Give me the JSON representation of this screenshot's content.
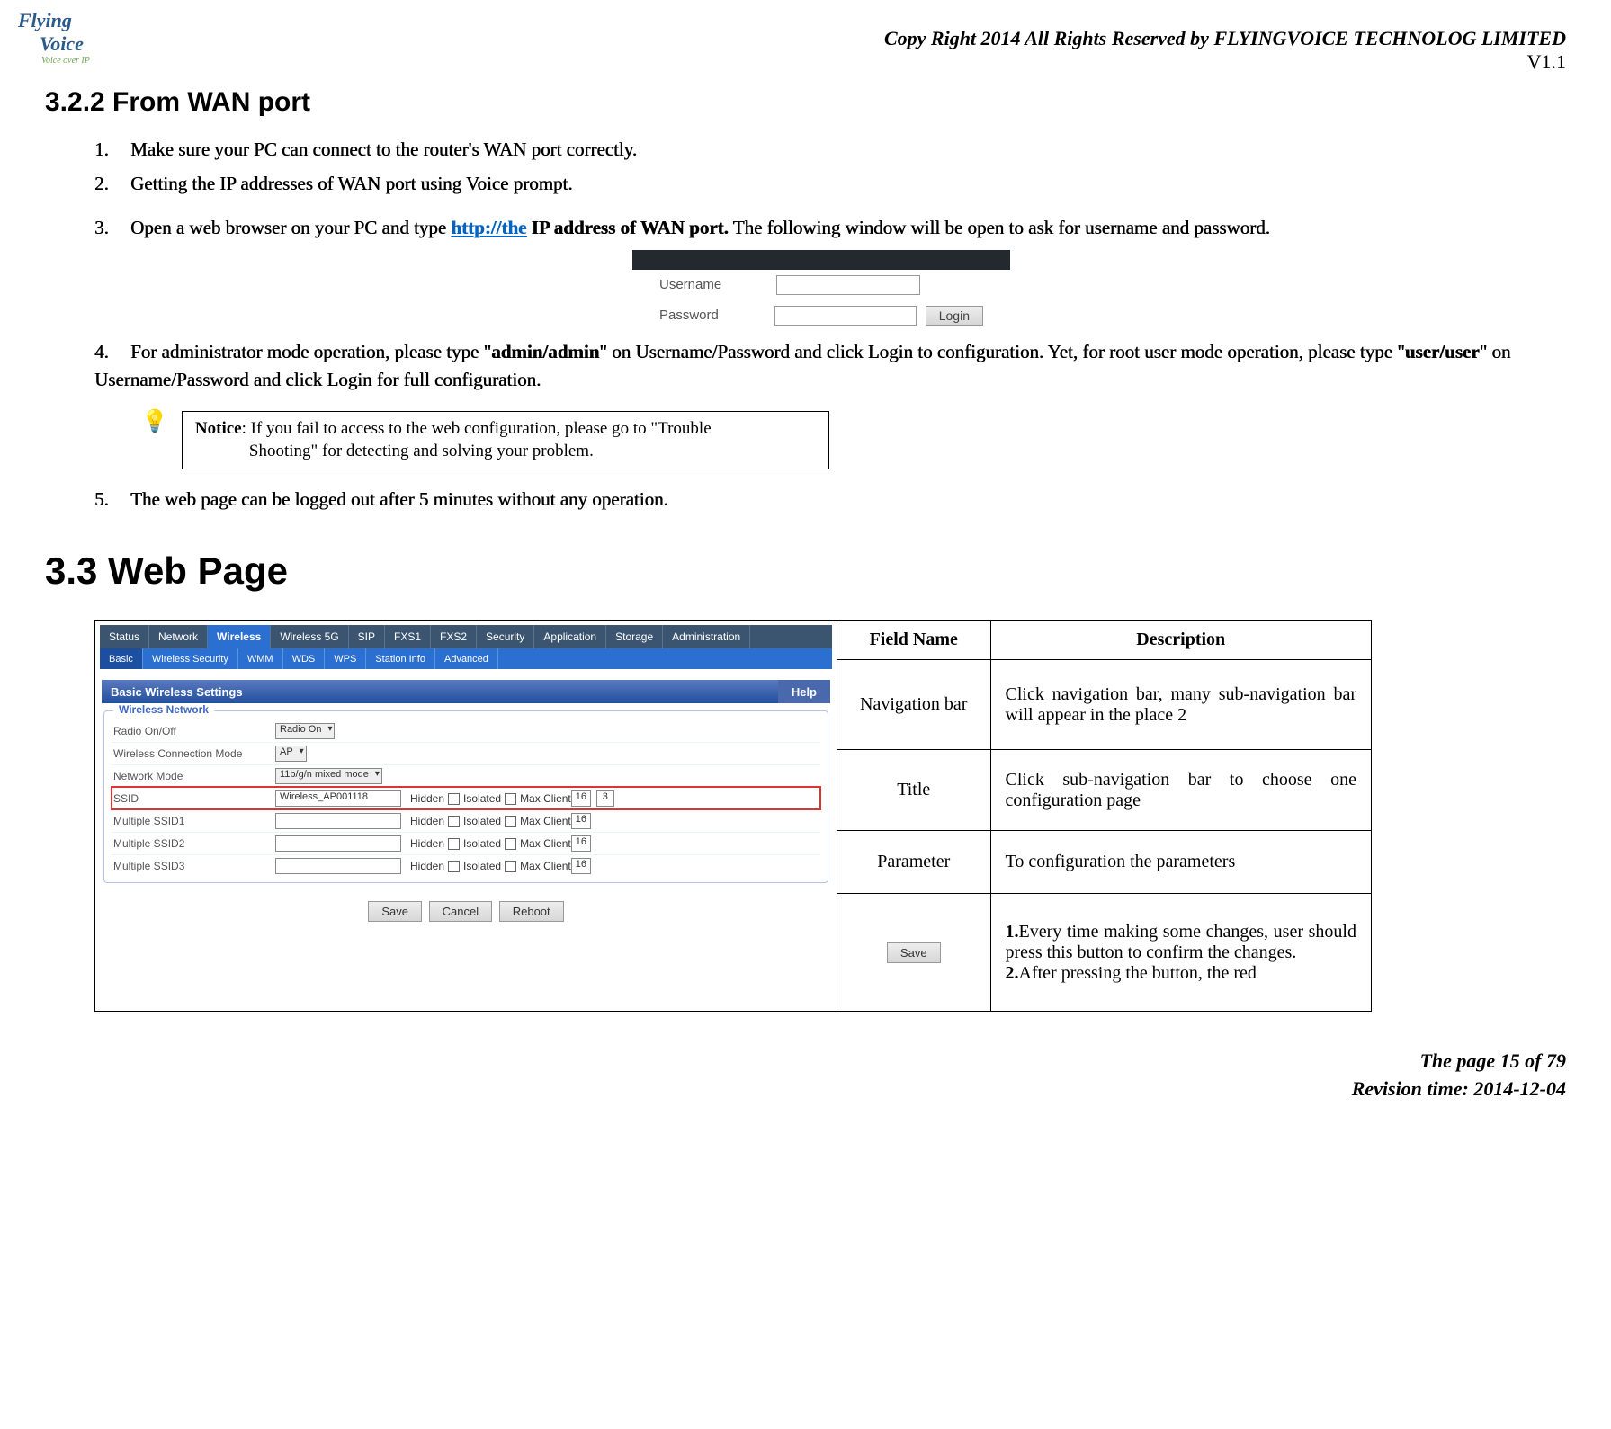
{
  "header": {
    "logo_line1": "Flying",
    "logo_line2": "Voice",
    "logo_tag": "Voice over IP",
    "copyright": "Copy Right 2014 All Rights Reserved by FLYINGVOICE TECHNOLOG LIMITED",
    "version": "V1.1"
  },
  "section_322": {
    "heading": "3.2.2 From WAN port",
    "item1_num": "1.",
    "item1_text": "Make sure your PC can connect to the router's WAN port correctly.",
    "item2_num": "2.",
    "item2_text": "Getting the IP addresses of WAN port using Voice prompt.",
    "item3_num": "3.",
    "item3_pre": "Open a web browser on your PC and type ",
    "item3_url": "http://the",
    "item3_bold": " IP address of WAN port.",
    "item3_post": " The following window will be open to ask for username and password.",
    "item4_num": "4.",
    "item4_pre": "For administrator mode operation, please type \"",
    "item4_adm": "admin/admin",
    "item4_mid": "\" on Username/Password and click Login to configuration. Yet, for root user mode operation, please type \"",
    "item4_usr": "user/user",
    "item4_post": "\" on Username/Password and click Login for full configuration.",
    "item5_num": "5.",
    "item5_text": "The web page can be logged out after 5 minutes without any operation."
  },
  "login_widget": {
    "username_label": "Username",
    "password_label": "Password",
    "login_btn": "Login"
  },
  "notice": {
    "prefix": "Notice",
    "line1": ": If you fail to access to the web configuration, please go to \"Trouble",
    "line2": "Shooting\" for detecting and solving your problem."
  },
  "section_33": {
    "heading": "3.3   Web Page"
  },
  "router_ui": {
    "nav1": [
      "Status",
      "Network",
      "Wireless",
      "Wireless 5G",
      "SIP",
      "FXS1",
      "FXS2",
      "Security",
      "Application",
      "Storage",
      "Administration"
    ],
    "nav1_selected": "Wireless",
    "nav2": [
      "Basic",
      "Wireless Security",
      "WMM",
      "WDS",
      "WPS",
      "Station Info",
      "Advanced"
    ],
    "nav2_selected": "Basic",
    "bar_title": "Basic Wireless Settings",
    "bar_help": "Help",
    "fieldset_legend": "Wireless Network",
    "rows": {
      "radio_label": "Radio On/Off",
      "radio_value": "Radio On",
      "mode_label": "Wireless Connection Mode",
      "mode_value": "AP",
      "net_label": "Network Mode",
      "net_value": "11b/g/n mixed mode",
      "ssid_label": "SSID",
      "ssid_value": "Wireless_AP001118",
      "mssid1_label": "Multiple SSID1",
      "mssid2_label": "Multiple SSID2",
      "mssid3_label": "Multiple SSID3",
      "hidden_label": "Hidden",
      "isolated_label": "Isolated",
      "maxclient_label": "Max Client",
      "maxclient_16": "16",
      "maxclient_3": "3"
    },
    "btn_save": "Save",
    "btn_cancel": "Cancel",
    "btn_reboot": "Reboot"
  },
  "desc_table": {
    "th_field": "Field Name",
    "th_desc": "Description",
    "r1_field": "Navigation bar",
    "r1_desc": "Click navigation bar, many sub-navigation bar will appear in the place 2",
    "r2_field": "Title",
    "r2_desc": "Click sub-navigation bar to choose one configuration page",
    "r3_field": "Parameter",
    "r3_desc": "To configuration the parameters",
    "r4_save": "Save",
    "r4_b1": "1.",
    "r4_l1": "Every time making some changes, user should press this button to confirm the changes.",
    "r4_b2": "2.",
    "r4_l2": "After pressing the button, the red"
  },
  "footer": {
    "page": "The page 15 of 79",
    "rev": "Revision time: 2014-12-04"
  }
}
